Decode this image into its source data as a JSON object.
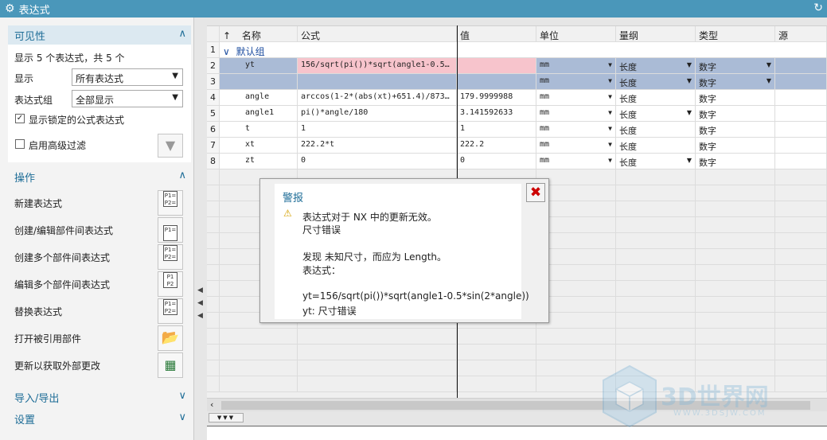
{
  "window": {
    "title": "表达式",
    "gear_icon": "gear-icon",
    "reset_icon": "refresh-icon"
  },
  "visibility": {
    "header": "可见性",
    "count_text": "显示 5 个表达式，共 5 个",
    "display_label": "显示",
    "display_value": "所有表达式",
    "group_label": "表达式组",
    "group_value": "全部显示",
    "locked_label": "显示锁定的公式表达式",
    "locked_checked": "✓",
    "advanced_label": "启用高级过滤"
  },
  "operations": {
    "header": "操作",
    "items": [
      "新建表达式",
      "创建/编辑部件间表达式",
      "创建多个部件间表达式",
      "编辑多个部件间表达式",
      "替换表达式",
      "打开被引用部件",
      "更新以获取外部更改"
    ]
  },
  "import_export": {
    "header": "导入/导出"
  },
  "settings": {
    "header": "设置"
  },
  "grid": {
    "sort_icon": "↑",
    "columns": [
      "名称",
      "公式",
      "值",
      "单位",
      "量纲",
      "类型",
      "源"
    ],
    "group_label": "默认组",
    "rows": [
      {
        "num": "1"
      },
      {
        "num": "2",
        "name": "yt",
        "formula": "156/sqrt(pi())*sqrt(angle1-0.5…",
        "value": "",
        "unit": "mm",
        "dim": "长度",
        "type": "数字"
      },
      {
        "num": "3",
        "name": "",
        "formula": "",
        "value": "",
        "unit": "mm",
        "dim": "长度",
        "type": "数字"
      },
      {
        "num": "4",
        "name": "angle",
        "formula": "arccos(1-2*(abs(xt)+651.4)/873…",
        "value": "179.9999988",
        "unit": "mm",
        "dim": "长度",
        "type": "数字"
      },
      {
        "num": "5",
        "name": "angle1",
        "formula": "pi()*angle/180",
        "value": "3.141592633",
        "unit": "mm",
        "dim": "长度",
        "type": "数字"
      },
      {
        "num": "6",
        "name": "t",
        "formula": "1",
        "value": "1",
        "unit": "mm",
        "dim": "长度",
        "type": "数字"
      },
      {
        "num": "7",
        "name": "xt",
        "formula": "222.2*t",
        "value": "222.2",
        "unit": "mm",
        "dim": "长度",
        "type": "数字"
      },
      {
        "num": "8",
        "name": "zt",
        "formula": "0",
        "value": "0",
        "unit": "mm",
        "dim": "长度",
        "type": "数字"
      }
    ]
  },
  "alert": {
    "title": "警报",
    "line1": "表达式对于 NX 中的更新无效。",
    "line2": "尺寸错误",
    "line3": "发现 未知尺寸，而应为 Length。",
    "line4": "表达式：",
    "line5": "yt=156/sqrt(pi())*sqrt(angle1-0.5*sin(2*angle))",
    "line6": "yt: 尺寸错误"
  },
  "watermark": {
    "text": "3D世界网",
    "url": "WWW.3DSJW.COM"
  },
  "colors": {
    "titlebar": "#4a97ba",
    "accent": "#1e6d97",
    "error_row": "#f7c4cc",
    "selected_row": "#aabbd6"
  }
}
